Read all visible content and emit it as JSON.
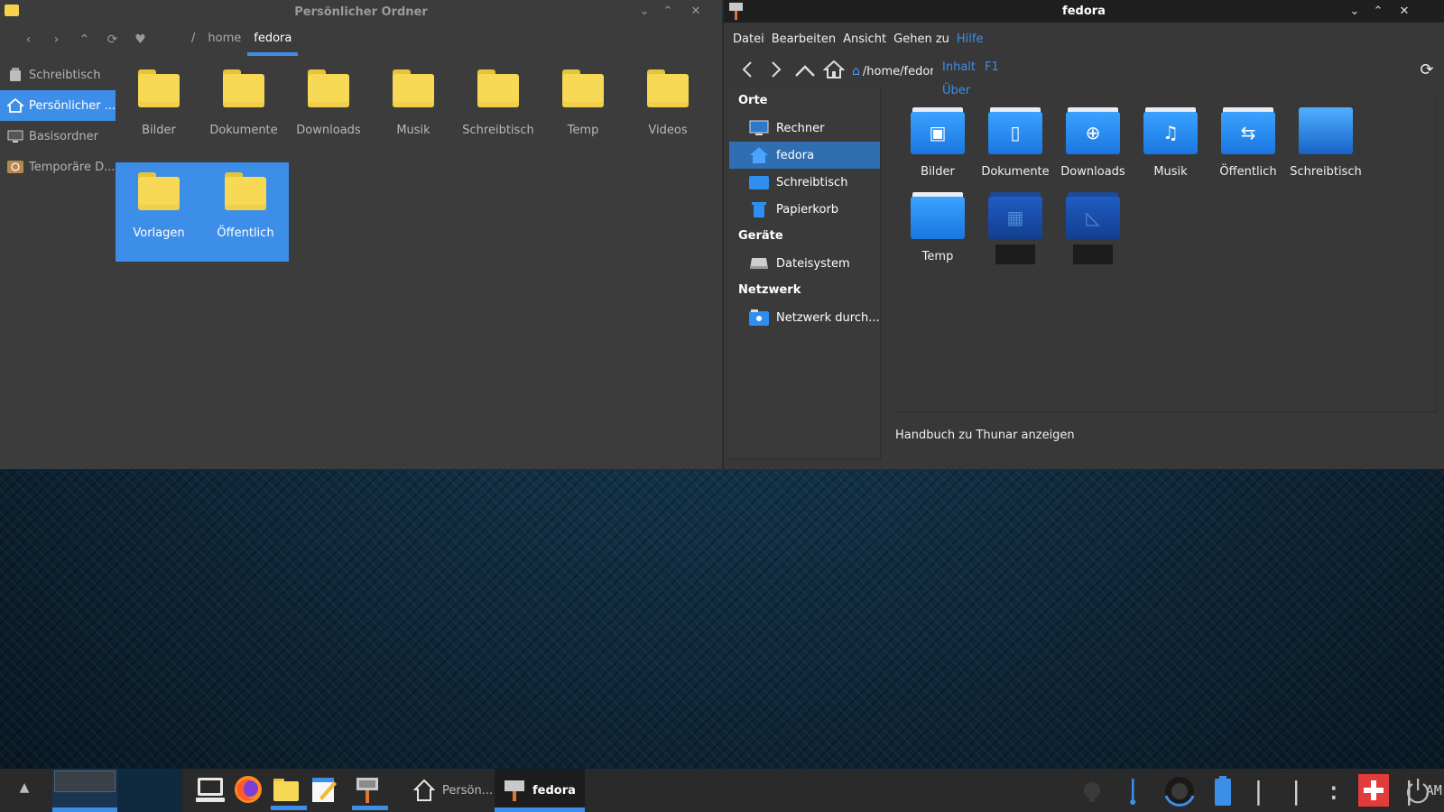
{
  "left_window": {
    "title": "Persönlicher Ordner",
    "toolbar": {
      "back": "‹",
      "forward": "›",
      "up": "⌃",
      "reload": "⟳",
      "bookmark": "♥"
    },
    "breadcrumb": [
      "/",
      "home",
      "fedora"
    ],
    "sidebar": [
      {
        "label": "Schreibtisch",
        "icon": "trash-desktop-icon",
        "selected": false
      },
      {
        "label": "Persönlicher ...",
        "icon": "home-icon",
        "selected": true
      },
      {
        "label": "Basisordner",
        "icon": "computer-icon",
        "selected": false
      },
      {
        "label": "Temporäre D...",
        "icon": "clock-folder-icon",
        "selected": false
      }
    ],
    "items": [
      {
        "label": "Bilder"
      },
      {
        "label": "Dokumente"
      },
      {
        "label": "Downloads"
      },
      {
        "label": "Musik"
      },
      {
        "label": "Schreibtisch"
      },
      {
        "label": "Temp"
      },
      {
        "label": "Videos"
      },
      {
        "label": "Vorlagen",
        "selected": true
      },
      {
        "label": "Öffentlich",
        "selected": true
      }
    ]
  },
  "right_window": {
    "title": "fedora",
    "menu": [
      "Datei",
      "Bearbeiten",
      "Ansicht",
      "Gehen zu",
      "Hilfe"
    ],
    "help_menu": [
      {
        "label": "Inhalt",
        "accel": "F1"
      },
      {
        "label": "Über",
        "accel": ""
      }
    ],
    "location": "/home/fedora",
    "sidebar": {
      "places_header": "Orte",
      "places": [
        {
          "label": "Rechner",
          "icon": "computer-icon"
        },
        {
          "label": "fedora",
          "icon": "home-icon",
          "selected": true
        },
        {
          "label": "Schreibtisch",
          "icon": "desktop-icon"
        },
        {
          "label": "Papierkorb",
          "icon": "trash-icon"
        }
      ],
      "devices_header": "Geräte",
      "devices": [
        {
          "label": "Dateisystem",
          "icon": "drive-icon"
        }
      ],
      "network_header": "Netzwerk",
      "network": [
        {
          "label": "Netzwerk durch...",
          "icon": "network-folder-icon"
        }
      ]
    },
    "items": [
      {
        "label": "Bilder",
        "glyph": "▣"
      },
      {
        "label": "Dokumente",
        "glyph": "▯"
      },
      {
        "label": "Downloads",
        "glyph": "⊕"
      },
      {
        "label": "Musik",
        "glyph": "♫"
      },
      {
        "label": "Öffentlich",
        "glyph": "⇆"
      },
      {
        "label": "Schreibtisch",
        "glyph": ""
      },
      {
        "label": "Temp",
        "glyph": ""
      },
      {
        "label": "",
        "glyph": "▦"
      },
      {
        "label": "",
        "glyph": "◺"
      }
    ],
    "status": "Handbuch zu Thunar anzeigen"
  },
  "taskbar": {
    "tasks": [
      {
        "label": "Persön...",
        "icon": "home-outline-icon",
        "active": false
      },
      {
        "label": "fedora",
        "icon": "thunar-icon",
        "active": true
      }
    ],
    "clock": {
      "time": "| | : 2 |",
      "ampm": "AM"
    }
  },
  "colors": {
    "accent": "#3d8ee8",
    "folder_yellow": "#f7d955",
    "folder_blue": "#2b8cf2"
  }
}
